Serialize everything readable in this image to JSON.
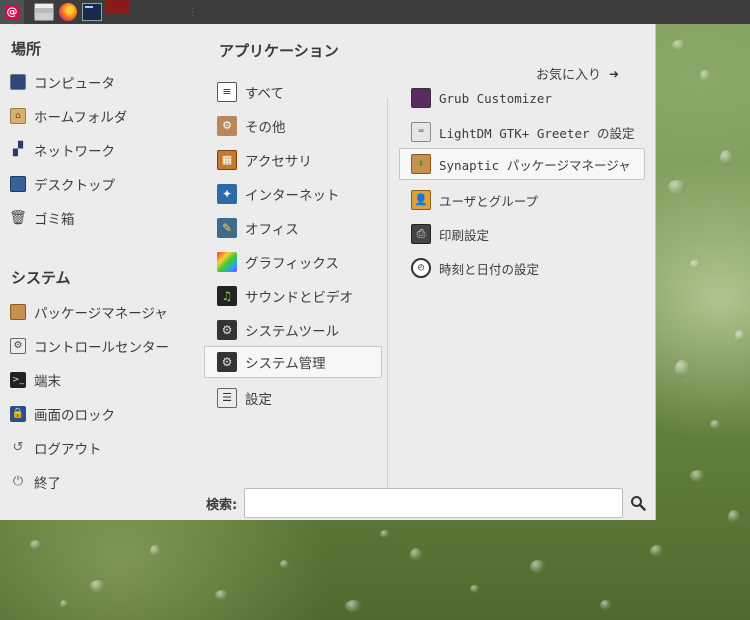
{
  "panel": {
    "launchers": [
      "debian-menu-icon",
      "file-manager-icon",
      "firefox-icon",
      "terminal-icon"
    ]
  },
  "menu": {
    "places_heading": "場所",
    "places": [
      {
        "label": "コンピュータ",
        "icon": "computer-icon"
      },
      {
        "label": "ホームフォルダ",
        "icon": "home-folder-icon"
      },
      {
        "label": "ネットワーク",
        "icon": "network-icon"
      },
      {
        "label": "デスクトップ",
        "icon": "desktop-icon"
      },
      {
        "label": "ゴミ箱",
        "icon": "trash-icon"
      }
    ],
    "system_heading": "システム",
    "system": [
      {
        "label": "パッケージマネージャ",
        "icon": "package-manager-icon"
      },
      {
        "label": "コントロールセンター",
        "icon": "control-center-icon"
      },
      {
        "label": "端末",
        "icon": "terminal-icon"
      },
      {
        "label": "画面のロック",
        "icon": "lock-screen-icon"
      },
      {
        "label": "ログアウト",
        "icon": "logout-icon"
      },
      {
        "label": "終了",
        "icon": "power-icon"
      }
    ],
    "apps_heading": "アプリケーション",
    "favorites_label": "お気に入り",
    "categories": [
      {
        "label": "すべて",
        "icon": "all-apps-icon"
      },
      {
        "label": "その他",
        "icon": "other-icon"
      },
      {
        "label": "アクセサリ",
        "icon": "accessories-icon"
      },
      {
        "label": "インターネット",
        "icon": "internet-icon"
      },
      {
        "label": "オフィス",
        "icon": "office-icon"
      },
      {
        "label": "グラフィックス",
        "icon": "graphics-icon"
      },
      {
        "label": "サウンドとビデオ",
        "icon": "sound-video-icon"
      },
      {
        "label": "システムツール",
        "icon": "system-tools-icon"
      },
      {
        "label": "システム管理",
        "icon": "system-admin-icon",
        "selected": true
      },
      {
        "label": "設定",
        "icon": "settings-icon"
      }
    ],
    "apps": [
      {
        "label": "Grub Customizer",
        "icon": "grub-customizer-icon"
      },
      {
        "label": "LightDM GTK+ Greeter の設定",
        "icon": "lightdm-icon"
      },
      {
        "label": "Synaptic パッケージマネージャ",
        "icon": "synaptic-icon",
        "selected": true
      },
      {
        "label": "ユーザとグループ",
        "icon": "users-groups-icon"
      },
      {
        "label": "印刷設定",
        "icon": "printer-icon"
      },
      {
        "label": "時刻と日付の設定",
        "icon": "clock-icon"
      }
    ],
    "search": {
      "label": "検索:",
      "value": "",
      "placeholder": ""
    }
  },
  "colors": {
    "menu_bg": "#ececec",
    "panel_bg": "#3c3c3c",
    "wallpaper": "#6d8c48"
  }
}
